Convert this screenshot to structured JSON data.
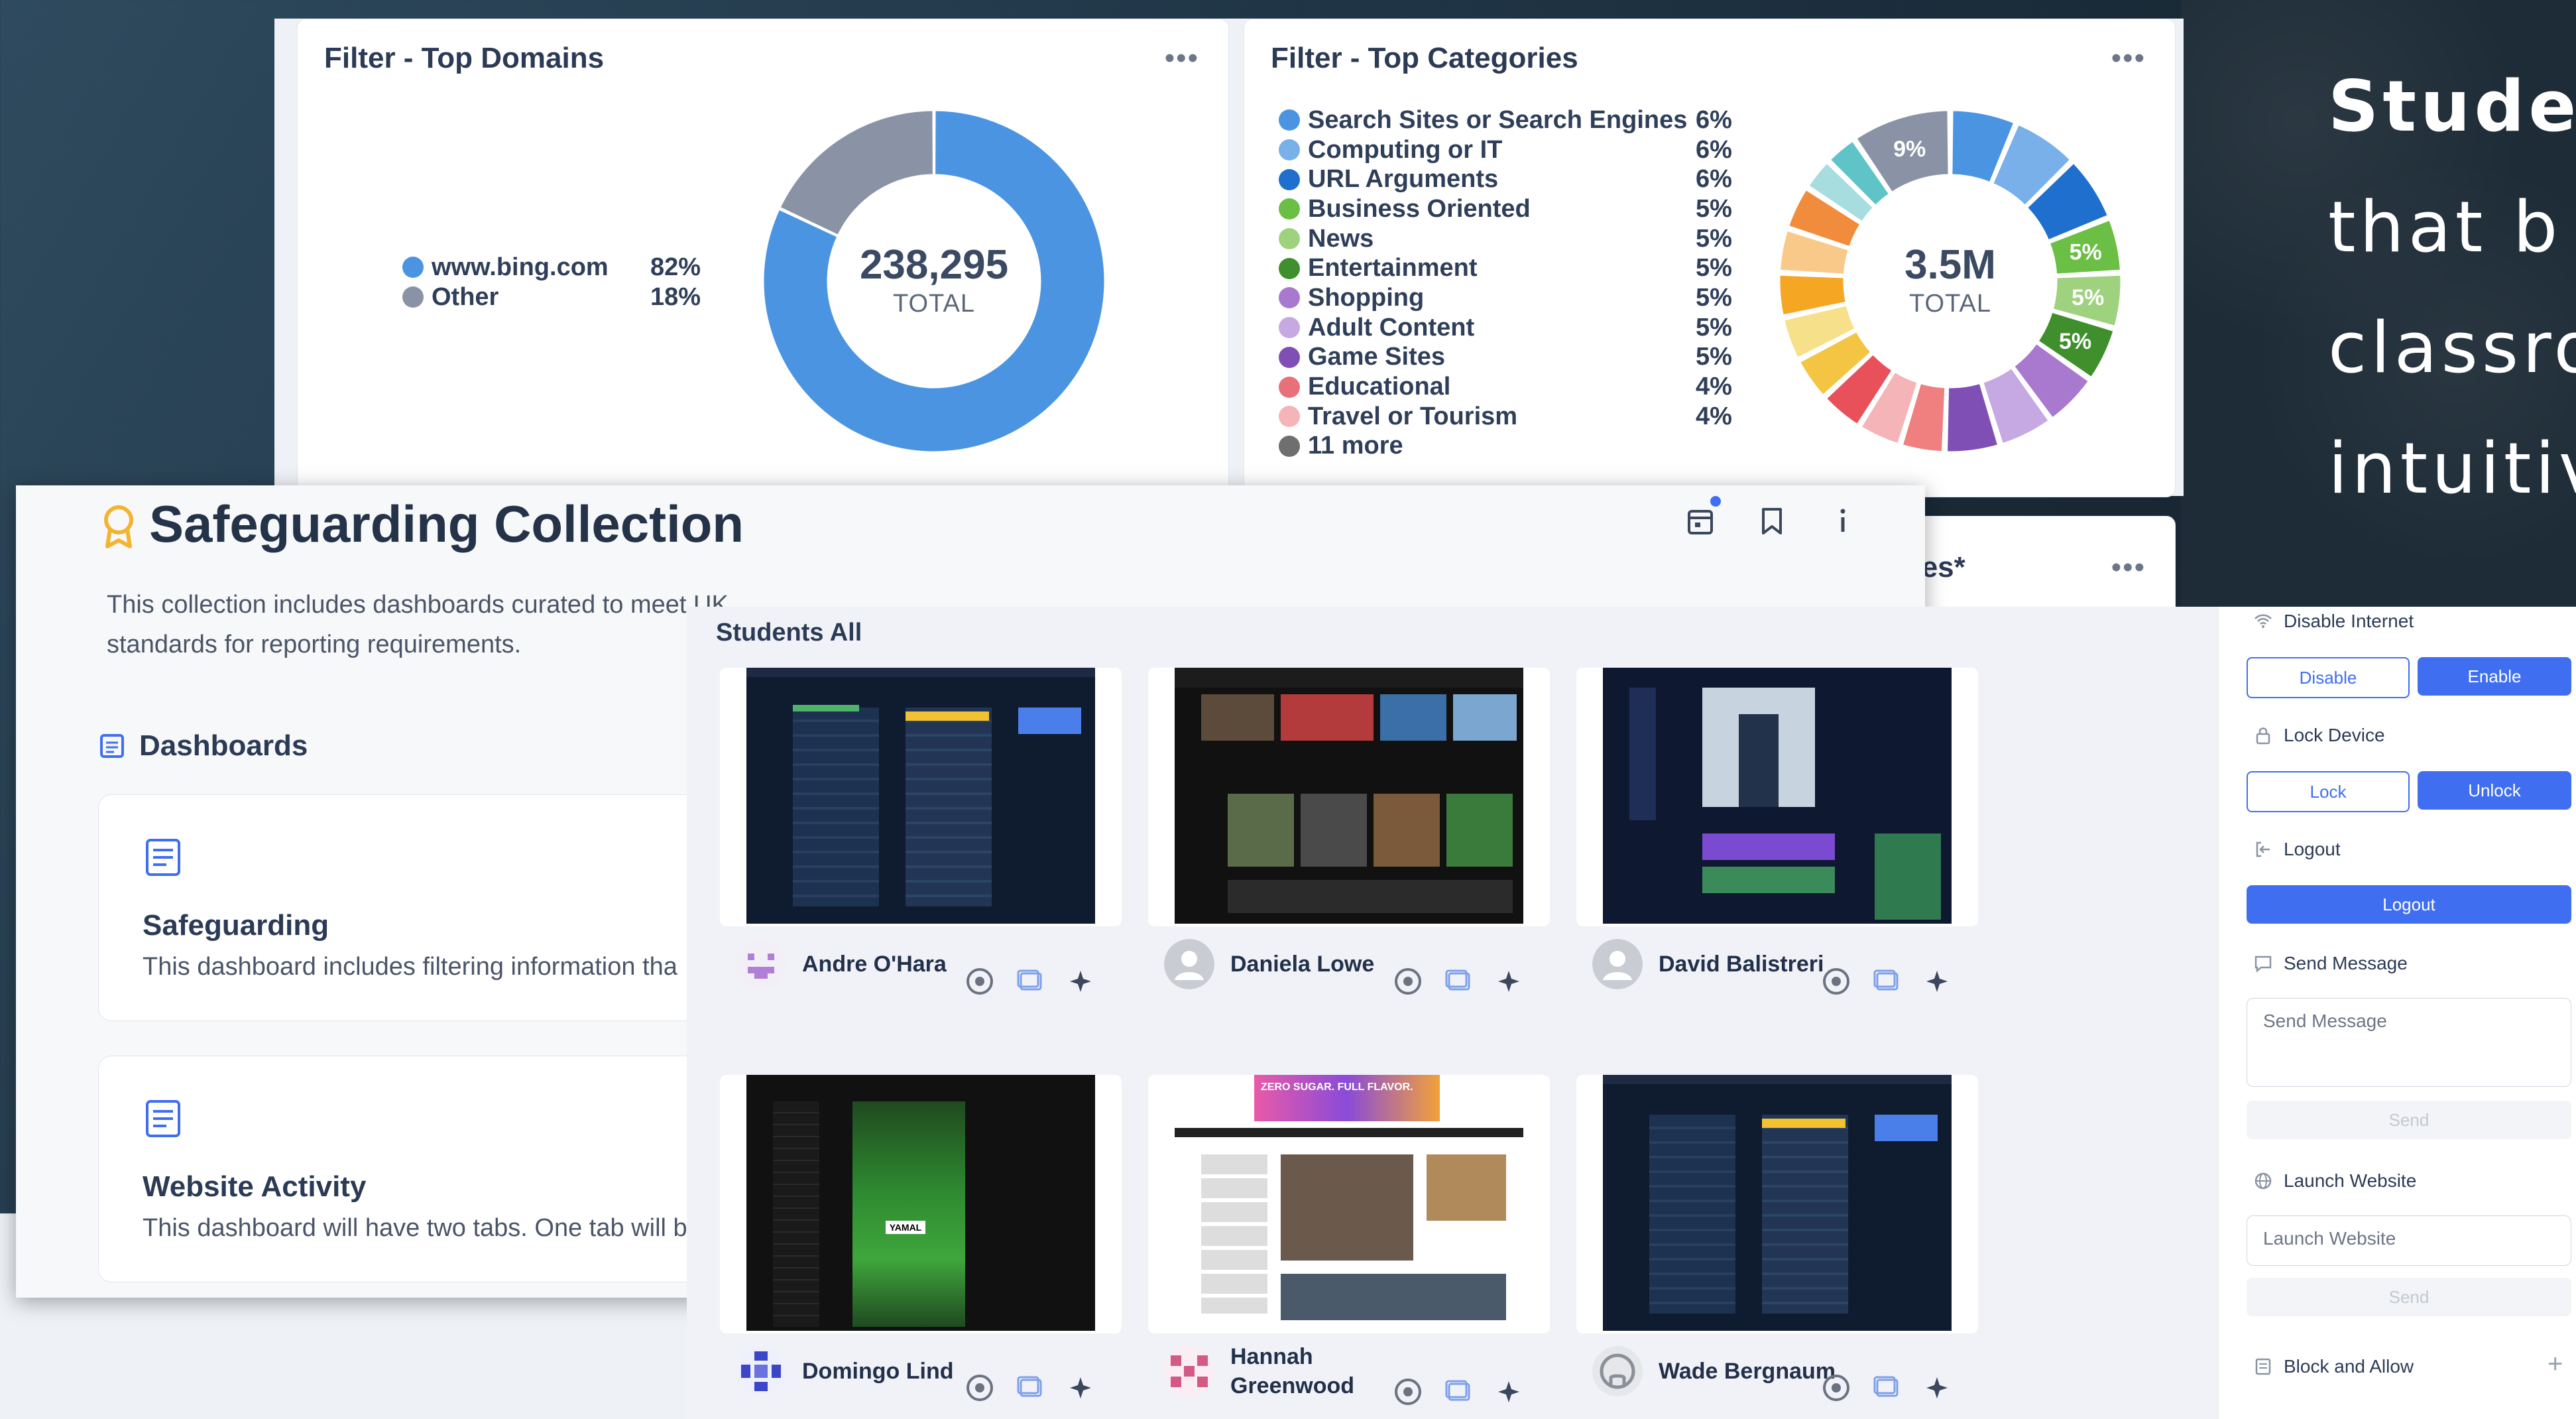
{
  "hero": {
    "line1": "Studen",
    "line2": "that  b",
    "line3": "classro",
    "line4": "intuitive"
  },
  "top_domains": {
    "title": "Filter - Top Domains",
    "menu": "•••",
    "total": "238,295",
    "total_label": "TOTAL",
    "legend": [
      {
        "name": "www.bing.com",
        "pct": "82%",
        "value": 82,
        "color": "#4a94e2"
      },
      {
        "name": "Other",
        "pct": "18%",
        "value": 18,
        "color": "#8a93a5"
      }
    ]
  },
  "top_categories": {
    "title": "Filter - Top Categories",
    "menu": "•••",
    "total": "3.5M",
    "total_label": "TOTAL",
    "legend": [
      {
        "name": "Search Sites or Search Engines",
        "pct": "6%",
        "color": "#4a94e2"
      },
      {
        "name": "Computing or IT",
        "pct": "6%",
        "color": "#79b0ea"
      },
      {
        "name": "URL Arguments",
        "pct": "6%",
        "color": "#1f6fce"
      },
      {
        "name": "Business Oriented",
        "pct": "5%",
        "color": "#6bbf45"
      },
      {
        "name": "News",
        "pct": "5%",
        "color": "#9fd27f"
      },
      {
        "name": "Entertainment",
        "pct": "5%",
        "color": "#3f8f2c"
      },
      {
        "name": "Shopping",
        "pct": "5%",
        "color": "#a879cf"
      },
      {
        "name": "Adult Content",
        "pct": "5%",
        "color": "#c6a8e3"
      },
      {
        "name": "Game Sites",
        "pct": "5%",
        "color": "#7f4fb6"
      },
      {
        "name": "Educational",
        "pct": "4%",
        "color": "#e8707a"
      },
      {
        "name": "Travel or Tourism",
        "pct": "4%",
        "color": "#f4b4b8"
      },
      {
        "name": "11 more",
        "pct": "",
        "color": "#6f6f6f"
      }
    ],
    "ring_labels": [
      "9%",
      "5%",
      "5%",
      "5%"
    ],
    "proxies_title": "xies*"
  },
  "collection": {
    "title": "Safeguarding Collection",
    "description": "This collection includes dashboards curated to meet UK standards for reporting requirements.",
    "section": "Dashboards",
    "dashboards": [
      {
        "title": "Safeguarding",
        "desc": "This dashboard includes filtering information tha"
      },
      {
        "title": "Website Activity",
        "desc": "This dashboard will have two tabs. One tab will b"
      }
    ]
  },
  "students": {
    "header": "Students All",
    "list": [
      {
        "name": "Andre O'Hara",
        "avatar": "pixel-face"
      },
      {
        "name": "Daniela Lowe",
        "avatar": "default-user"
      },
      {
        "name": "David Balistreri",
        "avatar": "default-user"
      },
      {
        "name": "Domingo Lind",
        "avatar": "pixel-pattern-blue"
      },
      {
        "name": "Hannah Greenwood",
        "avatar": "pixel-pattern-pink"
      },
      {
        "name": "Wade Bergnaum",
        "avatar": "github-octocat"
      }
    ],
    "screen_texts": {
      "zero_sugar": "ZERO SUGAR. FULL FLAVOR.",
      "yamal": "YAMAL"
    }
  },
  "controls": {
    "disable_internet": {
      "label": "Disable Internet",
      "disable": "Disable",
      "enable": "Enable"
    },
    "lock_device": {
      "label": "Lock Device",
      "lock": "Lock",
      "unlock": "Unlock"
    },
    "logout": {
      "label": "Logout",
      "button": "Logout"
    },
    "send_message": {
      "label": "Send Message",
      "placeholder": "Send Message",
      "send": "Send"
    },
    "launch_website": {
      "label": "Launch Website",
      "placeholder": "Launch Website",
      "send": "Send"
    },
    "block_allow": {
      "label": "Block and Allow",
      "add": "+"
    }
  },
  "colors": {
    "accent": "#3f6ff0",
    "badge_dot": "#3f6ff0"
  }
}
